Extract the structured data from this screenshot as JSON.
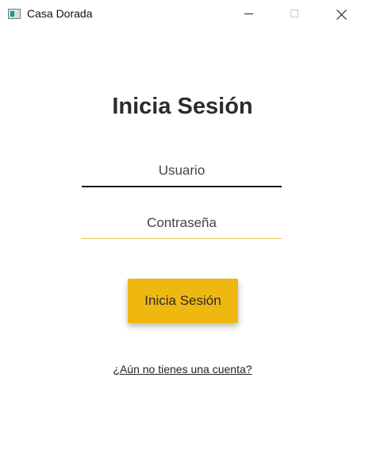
{
  "window": {
    "title": "Casa Dorada",
    "icon": "app-window-icon",
    "controls": {
      "minimize_icon": "minimize-icon",
      "maximize_icon": "maximize-icon",
      "close_icon": "close-icon"
    }
  },
  "login": {
    "heading": "Inicia Sesión",
    "username": {
      "placeholder": "Usuario",
      "value": ""
    },
    "password": {
      "placeholder": "Contraseña",
      "value": ""
    },
    "submit_label": "Inicia Sesión",
    "signup_link": "¿Aún no tienes una cuenta?"
  },
  "colors": {
    "accent": "#efb811",
    "background": "#ffffff",
    "text": "#2b2b2b"
  }
}
